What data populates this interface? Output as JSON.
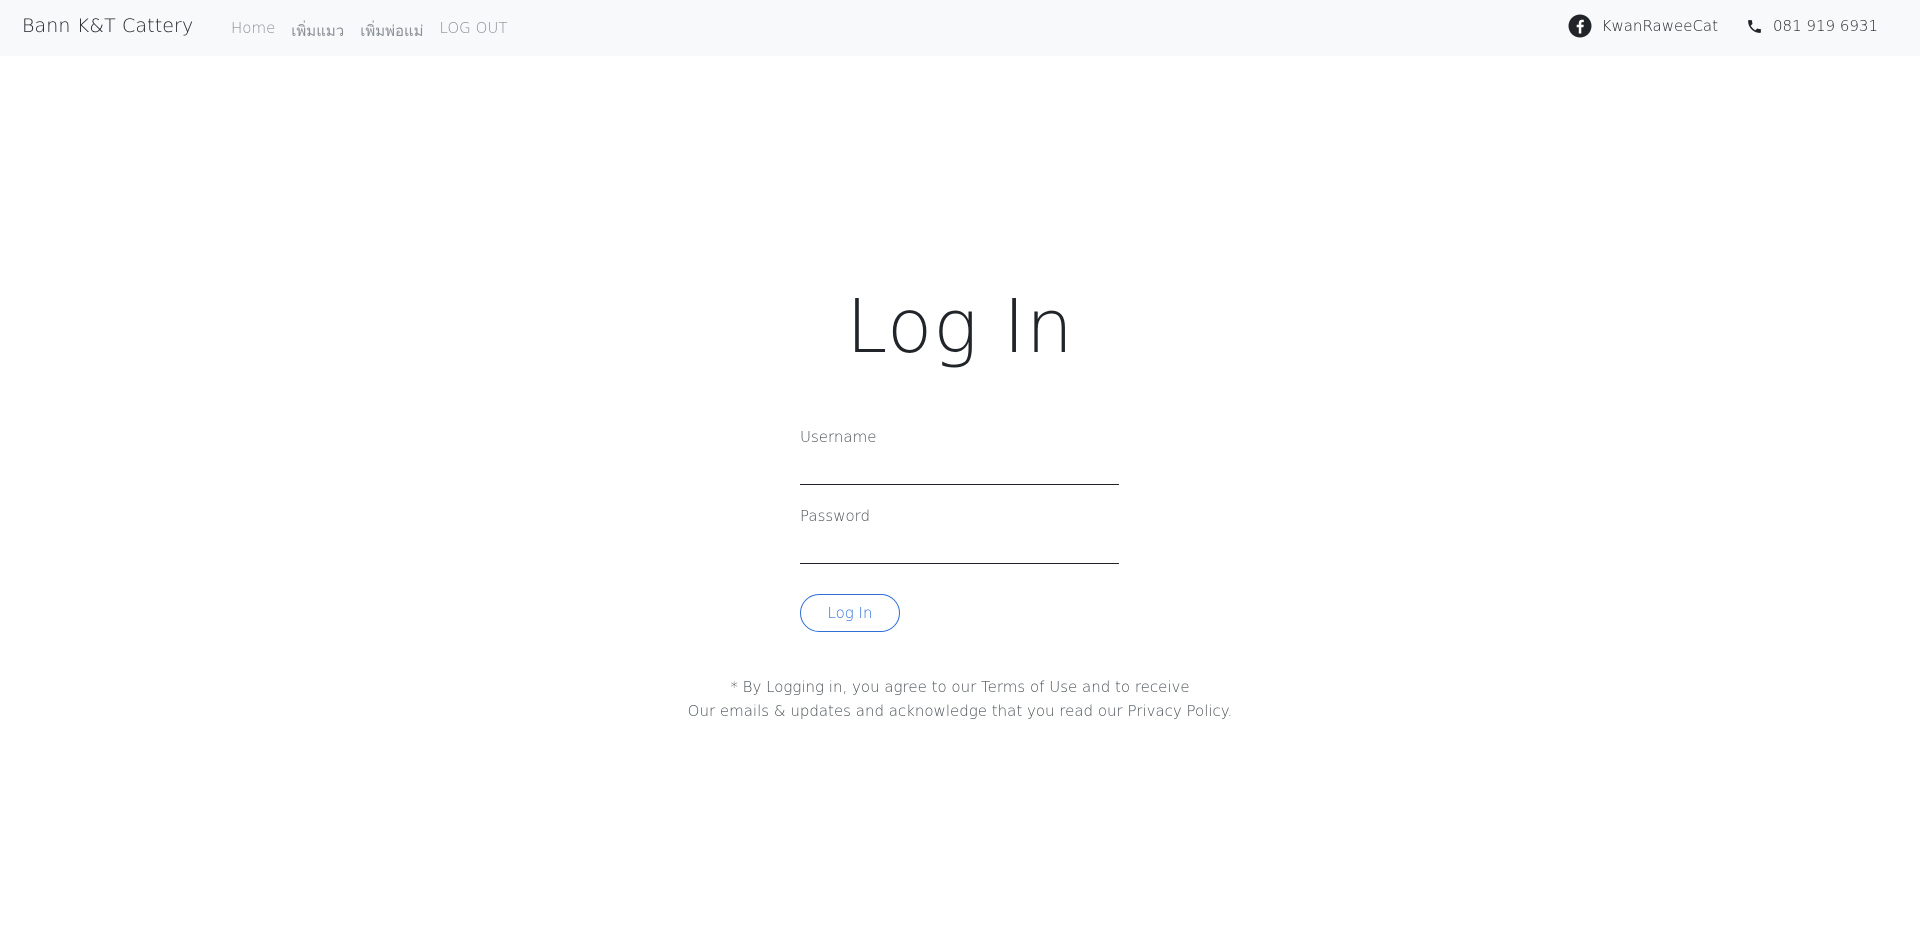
{
  "navbar": {
    "brand": "Bann K&T Cattery",
    "links": [
      "Home",
      "เพิ่มแมว",
      "เพิ่มพ่อแม่",
      "LOG OUT"
    ],
    "facebook": {
      "icon": "facebook-icon",
      "label": "KwanRaweeCat"
    },
    "phone": {
      "icon": "phone-icon",
      "label": "081 919 6931"
    }
  },
  "main": {
    "title": "Log In",
    "username_label": "Username",
    "username_value": "",
    "password_label": "Password",
    "password_value": "",
    "login_button": "Log In",
    "disclaimer_line1": "* By Logging in, you agree to our Terms of Use and to receive",
    "disclaimer_line2": "Our emails & updates and acknowledge that you read our Privacy Policy."
  },
  "colors": {
    "navbar_bg": "#f8f9fa",
    "accent": "#2f6fd6",
    "text": "#212529",
    "muted_link": "#8a8f94"
  }
}
